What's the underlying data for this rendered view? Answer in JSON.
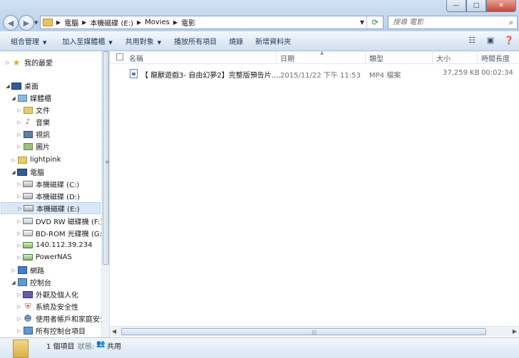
{
  "window": {
    "caption_buttons": {
      "minimize": "—",
      "maximize": "□",
      "close": "✕"
    }
  },
  "address": {
    "crumbs": [
      "電腦",
      "本機磁碟 (E:)",
      "Movies",
      "電影"
    ]
  },
  "search": {
    "placeholder": "搜尋 電影"
  },
  "commands": [
    "組合管理",
    "加入至媒體櫃",
    "共用對象",
    "播放所有項目",
    "燒錄",
    "新增資料夾"
  ],
  "nav": {
    "favorites": "我的最愛",
    "desktop": "桌面",
    "libraries": "媒體櫃",
    "lib_items": [
      "文件",
      "音樂",
      "視訊",
      "圖片"
    ],
    "user": "lightpink",
    "computer": "電腦",
    "drives": [
      "本機磁碟 (C:)",
      "本機磁碟 (D:)",
      "本機磁碟 (E:)",
      "DVD RW 磁碟機 (F:)",
      "BD-ROM 光碟機 (G:)"
    ],
    "network_locations": [
      "140.112.39.234",
      "PowerNAS"
    ],
    "network": "網路",
    "control_panel": "控制台",
    "cp_items": [
      "外觀及個人化",
      "系統及安全性",
      "使用者帳戶和家庭安全",
      "所有控制台項目"
    ]
  },
  "columns": {
    "name": "名稱",
    "date": "日期",
    "type": "類型",
    "size": "大小",
    "length": "時間長度"
  },
  "files": [
    {
      "name": "【 龍獸遊戲3- 自由幻夢2】完整版預告片....",
      "date": "2015/11/22 下午 11:53",
      "type": "MP4 檔案",
      "size": "37,259 KB",
      "length": "00:02:34"
    }
  ],
  "status": {
    "count": "1 個項目",
    "label": "狀態:",
    "share": "共用"
  }
}
